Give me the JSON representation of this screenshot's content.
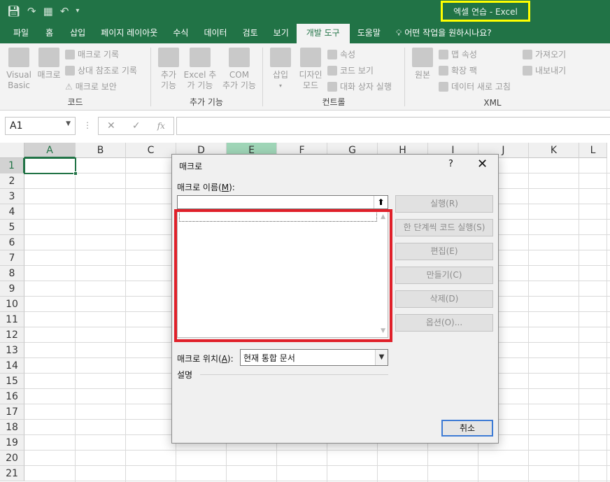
{
  "window": {
    "title": "엑셀 연습  -  Excel"
  },
  "qat": {
    "save_icon": "save-icon",
    "redo_icon": "redo-icon",
    "form_icon": "form-icon",
    "undo_icon": "undo-icon",
    "more_icon": "customize-icon"
  },
  "tabs": [
    {
      "label": "파일",
      "active": false
    },
    {
      "label": "홈",
      "active": false
    },
    {
      "label": "삽입",
      "active": false
    },
    {
      "label": "페이지 레이아웃",
      "active": false
    },
    {
      "label": "수식",
      "active": false
    },
    {
      "label": "데이터",
      "active": false
    },
    {
      "label": "검토",
      "active": false
    },
    {
      "label": "보기",
      "active": false
    },
    {
      "label": "개발 도구",
      "active": true
    },
    {
      "label": "도움말",
      "active": false
    }
  ],
  "tellme": "어떤 작업을 원하시나요?",
  "ribbon": {
    "code": {
      "label": "코드",
      "visual_basic_1": "Visual",
      "visual_basic_2": "Basic",
      "macro": "매크로",
      "record_macro": "매크로 기록",
      "relative_ref": "상대 참조로 기록",
      "macro_security": "매크로 보안"
    },
    "addins": {
      "label": "추가 기능",
      "addin_1": "추가",
      "addin_2": "기능",
      "excel_addin_1": "Excel 추",
      "excel_addin_2": "가 기능",
      "com_addin_1": "COM",
      "com_addin_2": "추가 기능"
    },
    "controls": {
      "label": "컨트롤",
      "insert": "삽입",
      "design_1": "디자인",
      "design_2": "모드",
      "properties": "속성",
      "view_code": "코드 보기",
      "run_dialog": "대화 상자 실행"
    },
    "xml": {
      "label": "XML",
      "source": "원본",
      "map_props": "맵 속성",
      "expansion_packs": "확장 팩",
      "refresh_data": "데이터 새로 고침",
      "import": "가져오기",
      "export": "내보내기"
    }
  },
  "formula_bar": {
    "name_box": "A1",
    "cancel_glyph": "✕",
    "enter_glyph": "✓",
    "fx_glyph": "fx",
    "value": ""
  },
  "grid": {
    "columns": [
      "A",
      "B",
      "C",
      "D",
      "E",
      "F",
      "G",
      "H",
      "I",
      "J",
      "K",
      "L"
    ],
    "rows": [
      "1",
      "2",
      "3",
      "4",
      "5",
      "6",
      "7",
      "8",
      "9",
      "10",
      "11",
      "12",
      "13",
      "14",
      "15",
      "16",
      "17",
      "18",
      "19",
      "20",
      "21"
    ]
  },
  "dialog": {
    "title": "매크로",
    "help": "?",
    "close": "✕",
    "name_label_pre": "매크로 이름(",
    "name_label_key": "M",
    "name_label_post": "):",
    "name_value": "",
    "buttons": {
      "run": "실행(R)",
      "step_into": "한 단계씩 코드 실행(S)",
      "edit": "편집(E)",
      "create": "만들기(C)",
      "delete": "삭제(D)",
      "options": "옵션(O)..."
    },
    "location_label_pre": "매크로 위치(",
    "location_label_key": "A",
    "location_label_post": "):",
    "location_value": "현재 통합 문서",
    "description_label": "설명",
    "cancel": "취소"
  }
}
